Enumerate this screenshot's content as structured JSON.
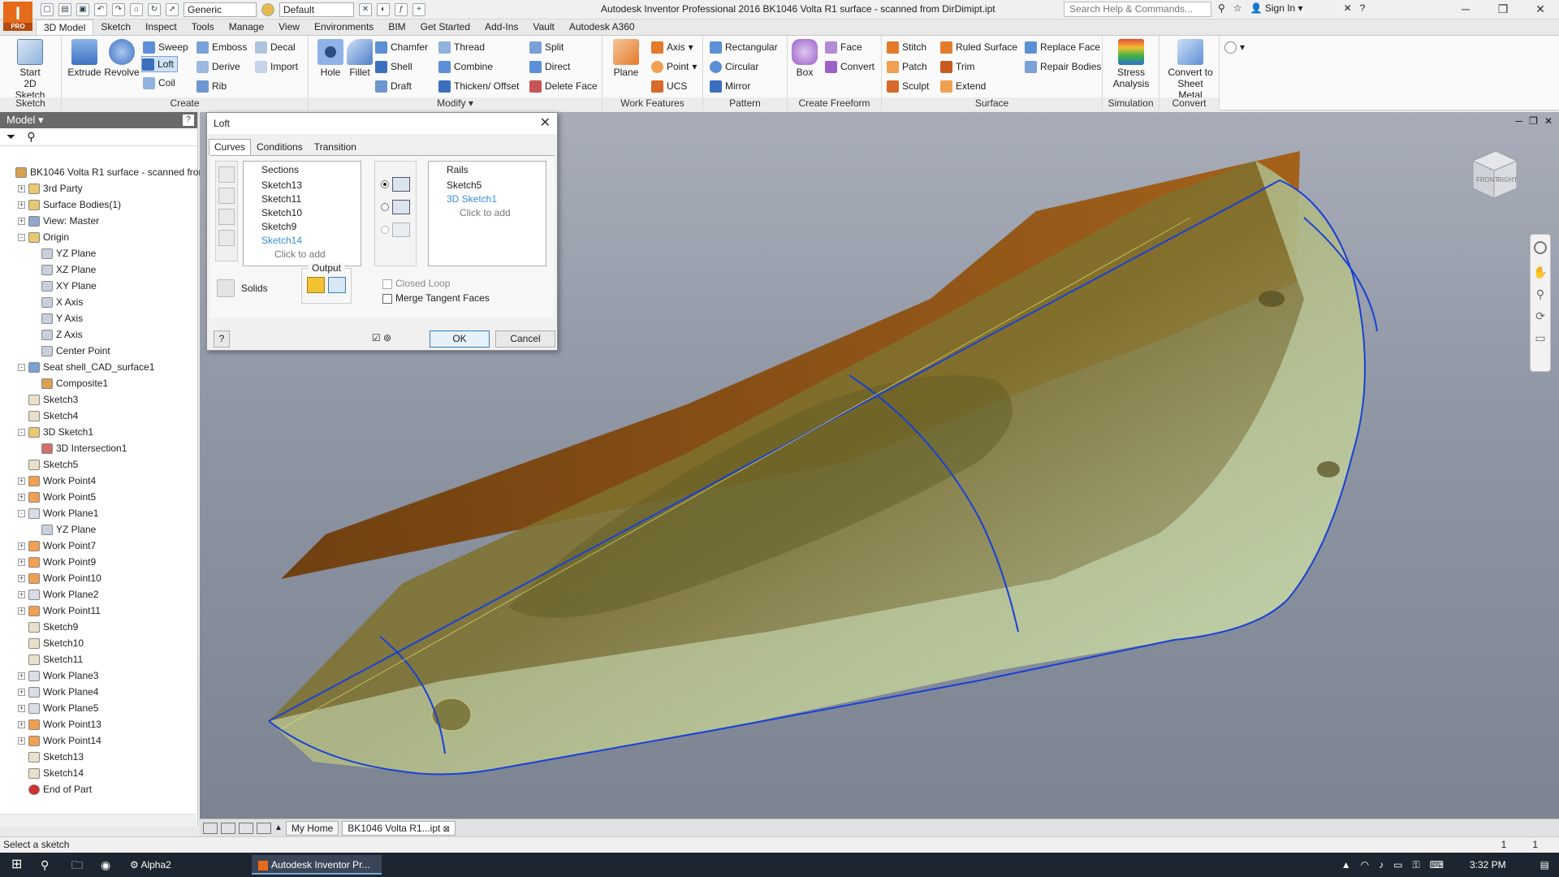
{
  "app": {
    "logo_text": "I",
    "logo_sub": "PRO",
    "title": "Autodesk Inventor Professional 2016   BK1046 Volta R1 surface - scanned from DirDimipt.ipt",
    "material_combo": "Generic",
    "appearance_combo": "Default",
    "search_placeholder": "Search Help & Commands...",
    "sign_in": "Sign In"
  },
  "tabs": [
    "3D Model",
    "Sketch",
    "Inspect",
    "Tools",
    "Manage",
    "View",
    "Environments",
    "BIM",
    "Get Started",
    "Add-Ins",
    "Vault",
    "Autodesk A360"
  ],
  "ribbon": {
    "sketch_panel": {
      "title": "Sketch",
      "start": "Start\n2D Sketch"
    },
    "create_panel": {
      "title": "Create",
      "extrude": "Extrude",
      "revolve": "Revolve",
      "sweep": "Sweep",
      "loft": "Loft",
      "coil": "Coil",
      "emboss": "Emboss",
      "derive": "Derive",
      "rib": "Rib",
      "decal": "Decal",
      "import": "Import"
    },
    "modify_panel": {
      "title": "Modify ▾",
      "hole": "Hole",
      "fillet": "Fillet",
      "chamfer": "Chamfer",
      "shell": "Shell",
      "draft": "Draft",
      "thread": "Thread",
      "combine": "Combine",
      "thicken": "Thicken/ Offset",
      "split": "Split",
      "direct": "Direct",
      "delete_face": "Delete Face"
    },
    "work_panel": {
      "title": "Work Features",
      "plane": "Plane",
      "axis": "Axis",
      "point": "Point",
      "ucs": "UCS"
    },
    "pattern_panel": {
      "title": "Pattern",
      "rect": "Rectangular",
      "circ": "Circular",
      "mirror": "Mirror"
    },
    "freeform_panel": {
      "title": "Create Freeform",
      "box": "Box",
      "face": "Face",
      "convert": "Convert"
    },
    "surface_panel": {
      "title": "Surface",
      "stitch": "Stitch",
      "patch": "Patch",
      "sculpt": "Sculpt",
      "ruled": "Ruled Surface",
      "trim": "Trim",
      "extend": "Extend",
      "replace": "Replace Face",
      "repair": "Repair Bodies"
    },
    "sim_panel": {
      "title": "Simulation",
      "stress": "Stress\nAnalysis"
    },
    "convert_panel": {
      "title": "Convert",
      "sheet": "Convert to\nSheet Metal"
    }
  },
  "browser": {
    "header": "Model ▾",
    "items": [
      {
        "label": "BK1046 Volta R1 surface - scanned fror",
        "indent": 0,
        "exp": "",
        "icon": "part-icon"
      },
      {
        "label": "3rd Party",
        "indent": 1,
        "exp": "+",
        "icon": "folder-icon"
      },
      {
        "label": "Surface Bodies(1)",
        "indent": 1,
        "exp": "+",
        "icon": "folder-icon"
      },
      {
        "label": "View: Master",
        "indent": 1,
        "exp": "+",
        "icon": "view-icon"
      },
      {
        "label": "Origin",
        "indent": 1,
        "exp": "-",
        "icon": "folder-icon"
      },
      {
        "label": "YZ Plane",
        "indent": 2,
        "exp": "",
        "icon": "plane-icon"
      },
      {
        "label": "XZ Plane",
        "indent": 2,
        "exp": "",
        "icon": "plane-icon"
      },
      {
        "label": "XY Plane",
        "indent": 2,
        "exp": "",
        "icon": "plane-icon"
      },
      {
        "label": "X Axis",
        "indent": 2,
        "exp": "",
        "icon": "axis-icon"
      },
      {
        "label": "Y Axis",
        "indent": 2,
        "exp": "",
        "icon": "axis-icon"
      },
      {
        "label": "Z Axis",
        "indent": 2,
        "exp": "",
        "icon": "axis-icon"
      },
      {
        "label": "Center Point",
        "indent": 2,
        "exp": "",
        "icon": "point-icon"
      },
      {
        "label": "Seat shell_CAD_surface1",
        "indent": 1,
        "exp": "-",
        "icon": "surface-icon"
      },
      {
        "label": "Composite1",
        "indent": 2,
        "exp": "",
        "icon": "composite-icon"
      },
      {
        "label": "Sketch3",
        "indent": 1,
        "exp": "",
        "icon": "sketch-icon"
      },
      {
        "label": "Sketch4",
        "indent": 1,
        "exp": "",
        "icon": "sketch-icon"
      },
      {
        "label": "3D Sketch1",
        "indent": 1,
        "exp": "-",
        "icon": "sketch3d-icon"
      },
      {
        "label": "3D Intersection1",
        "indent": 2,
        "exp": "",
        "icon": "intersection-icon"
      },
      {
        "label": "Sketch5",
        "indent": 1,
        "exp": "",
        "icon": "sketch-icon"
      },
      {
        "label": "Work Point4",
        "indent": 1,
        "exp": "+",
        "icon": "workpoint-icon"
      },
      {
        "label": "Work Point5",
        "indent": 1,
        "exp": "+",
        "icon": "workpoint-icon"
      },
      {
        "label": "Work Plane1",
        "indent": 1,
        "exp": "-",
        "icon": "workplane-icon"
      },
      {
        "label": "YZ Plane",
        "indent": 2,
        "exp": "",
        "icon": "plane-icon"
      },
      {
        "label": "Work Point7",
        "indent": 1,
        "exp": "+",
        "icon": "workpoint-icon"
      },
      {
        "label": "Work Point9",
        "indent": 1,
        "exp": "+",
        "icon": "workpoint-icon"
      },
      {
        "label": "Work Point10",
        "indent": 1,
        "exp": "+",
        "icon": "workpoint-icon"
      },
      {
        "label": "Work Plane2",
        "indent": 1,
        "exp": "+",
        "icon": "workplane-icon"
      },
      {
        "label": "Work Point11",
        "indent": 1,
        "exp": "+",
        "icon": "workpoint-icon"
      },
      {
        "label": "Sketch9",
        "indent": 1,
        "exp": "",
        "icon": "sketch-icon"
      },
      {
        "label": "Sketch10",
        "indent": 1,
        "exp": "",
        "icon": "sketch-icon"
      },
      {
        "label": "Sketch11",
        "indent": 1,
        "exp": "",
        "icon": "sketch-icon"
      },
      {
        "label": "Work Plane3",
        "indent": 1,
        "exp": "+",
        "icon": "workplane-icon"
      },
      {
        "label": "Work Plane4",
        "indent": 1,
        "exp": "+",
        "icon": "workplane-icon"
      },
      {
        "label": "Work Plane5",
        "indent": 1,
        "exp": "+",
        "icon": "workplane-icon"
      },
      {
        "label": "Work Point13",
        "indent": 1,
        "exp": "+",
        "icon": "workpoint-icon"
      },
      {
        "label": "Work Point14",
        "indent": 1,
        "exp": "+",
        "icon": "workpoint-icon"
      },
      {
        "label": "Sketch13",
        "indent": 1,
        "exp": "",
        "icon": "sketch-icon"
      },
      {
        "label": "Sketch14",
        "indent": 1,
        "exp": "",
        "icon": "sketch-icon"
      },
      {
        "label": "End of Part",
        "indent": 1,
        "exp": "",
        "icon": "end-of-part-icon"
      }
    ]
  },
  "dialog": {
    "title": "Loft",
    "tabs": [
      "Curves",
      "Conditions",
      "Transition"
    ],
    "sections_header": "Sections",
    "sections": [
      {
        "label": "Sketch13",
        "hl": false
      },
      {
        "label": "Sketch11",
        "hl": false
      },
      {
        "label": "Sketch10",
        "hl": false
      },
      {
        "label": "Sketch9",
        "hl": false
      },
      {
        "label": "Sketch14",
        "hl": true
      }
    ],
    "sections_add": "Click to add",
    "rails_header": "Rails",
    "rails": [
      {
        "label": "Sketch5",
        "hl": false
      },
      {
        "label": "3D Sketch1",
        "hl": true
      }
    ],
    "rails_add": "Click to add",
    "output_label": "Output",
    "solids_label": "Solids",
    "closed_loop": "Closed Loop",
    "merge_tangent": "Merge Tangent Faces",
    "ok": "OK",
    "cancel": "Cancel"
  },
  "viewcube": {
    "front": "FRONT",
    "right": "RIGHT"
  },
  "doc_tabs": {
    "home": "My Home",
    "doc": "BK1046 Volta R1...ipt"
  },
  "status": {
    "message": "Select a sketch",
    "n1": "1",
    "n2": "1"
  },
  "taskbar": {
    "item1": "Alpha2",
    "item2": "Autodesk Inventor Pr...",
    "clock": "3:32 PM"
  }
}
